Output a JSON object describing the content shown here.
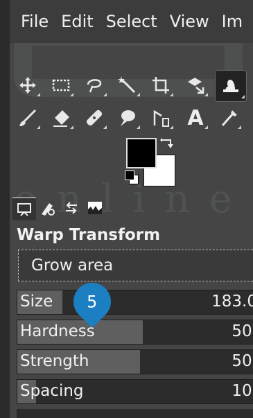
{
  "menubar": {
    "items": [
      {
        "label": "File"
      },
      {
        "label": "Edit"
      },
      {
        "label": "Select"
      },
      {
        "label": "View"
      },
      {
        "label": "Im"
      }
    ]
  },
  "toolbox": {
    "row1": [
      {
        "icon": "move-icon"
      },
      {
        "icon": "rect-select-icon"
      },
      {
        "icon": "free-select-icon"
      },
      {
        "icon": "fuzzy-select-icon"
      },
      {
        "icon": "crop-icon"
      },
      {
        "icon": "unified-transform-icon"
      },
      {
        "icon": "warp-transform-icon",
        "active": true
      }
    ],
    "row2": [
      {
        "icon": "paintbrush-icon"
      },
      {
        "icon": "eraser-icon"
      },
      {
        "icon": "heal-icon"
      },
      {
        "icon": "smudge-icon"
      },
      {
        "icon": "paths-icon"
      },
      {
        "icon": "text-icon",
        "glyph": "A"
      },
      {
        "icon": "color-picker-icon"
      }
    ],
    "fg_color": "#000000",
    "bg_color": "#ffffff"
  },
  "dock_tabs": [
    {
      "icon": "tool-options-icon",
      "selected": true
    },
    {
      "icon": "device-status-icon"
    },
    {
      "icon": "undo-history-icon"
    },
    {
      "icon": "images-icon"
    }
  ],
  "tool_options": {
    "title": "Warp Transform",
    "behavior": "Grow area",
    "sliders": [
      {
        "label": "Size",
        "value": "183.0",
        "level": 0.19
      },
      {
        "label": "Hardness",
        "value": "50.",
        "level": 0.53
      },
      {
        "label": "Strength",
        "value": "50.",
        "level": 0.52
      },
      {
        "label": "Spacing",
        "value": "10.",
        "level": 0.08
      }
    ]
  },
  "callout": {
    "number": "5",
    "color": "#1b7fc2"
  }
}
